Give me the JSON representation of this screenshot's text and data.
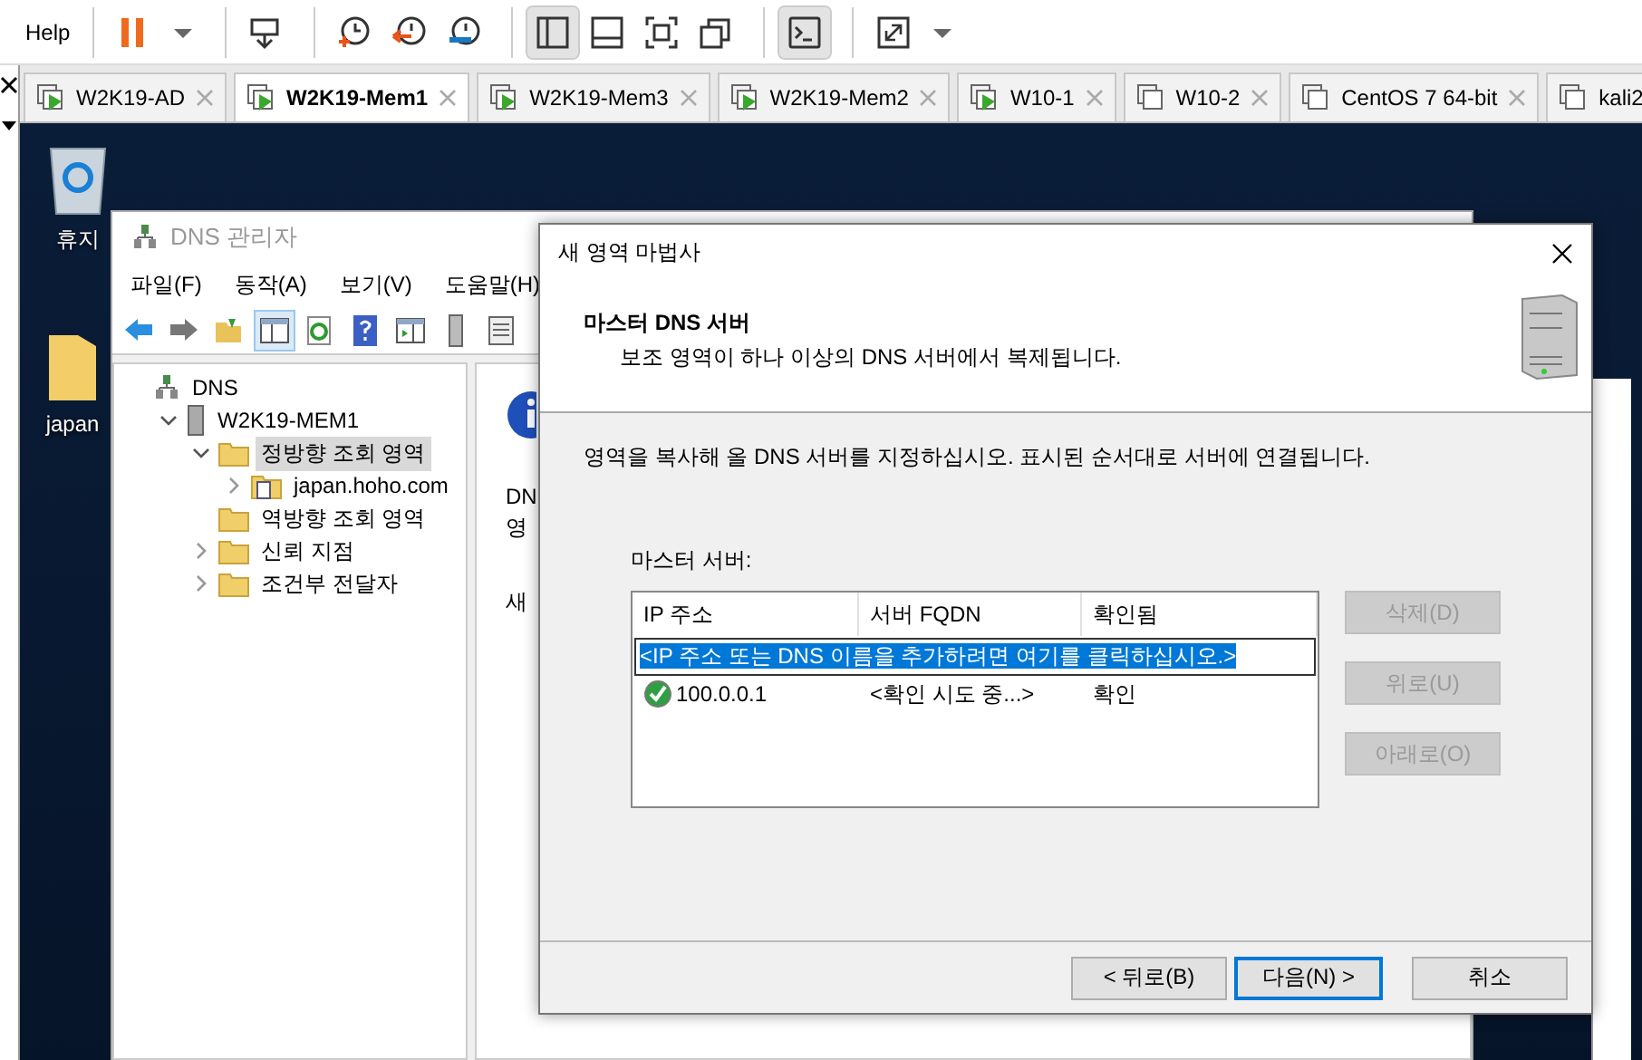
{
  "toolbar": {
    "help": "Help",
    "tool_groups": [
      [
        {
          "kind": "pause",
          "on": false
        },
        {
          "kind": "caret",
          "on": false
        }
      ],
      [
        {
          "kind": "send-keys",
          "on": false
        }
      ],
      [
        {
          "kind": "snapshot",
          "on": false
        },
        {
          "kind": "revert",
          "on": false
        },
        {
          "kind": "manage",
          "on": false
        }
      ],
      [
        {
          "kind": "sidebar",
          "on": true
        },
        {
          "kind": "bottom-panel",
          "on": false
        },
        {
          "kind": "fit",
          "on": false
        },
        {
          "kind": "restore",
          "on": false
        }
      ],
      [
        {
          "kind": "console",
          "on": true
        }
      ],
      [
        {
          "kind": "stretch",
          "on": false
        },
        {
          "kind": "caret",
          "on": false
        }
      ]
    ]
  },
  "tabs": [
    {
      "label": "W2K19-AD",
      "running": true,
      "selected": false
    },
    {
      "label": "W2K19-Mem1",
      "running": true,
      "selected": true
    },
    {
      "label": "W2K19-Mem3",
      "running": true,
      "selected": false
    },
    {
      "label": "W2K19-Mem2",
      "running": true,
      "selected": false
    },
    {
      "label": "W10-1",
      "running": true,
      "selected": false
    },
    {
      "label": "W10-2",
      "running": false,
      "selected": false
    },
    {
      "label": "CentOS 7 64-bit",
      "running": false,
      "selected": false
    },
    {
      "label": "kali2",
      "running": false,
      "selected": false
    }
  ],
  "desktop_icons": [
    {
      "kind": "recycle-bin",
      "label": "휴지"
    },
    {
      "kind": "folder",
      "label": "japan"
    }
  ],
  "dns_window": {
    "title": "DNS 관리자",
    "menu": [
      "파일(F)",
      "동작(A)",
      "보기(V)",
      "도움말(H)"
    ],
    "tools": [
      {
        "kind": "back",
        "on": false
      },
      {
        "kind": "forward",
        "on": false
      },
      {
        "kind": "up",
        "on": false
      },
      {
        "kind": "tree",
        "on": true
      },
      {
        "kind": "refresh",
        "on": false
      },
      {
        "kind": "help",
        "on": false
      },
      {
        "kind": "action-pane",
        "on": false
      },
      {
        "kind": "server",
        "on": false
      },
      {
        "kind": "list",
        "on": false
      }
    ],
    "tree": [
      {
        "label": "DNS",
        "kind": "root",
        "expandable": false,
        "selected": false,
        "children": [
          {
            "label": "W2K19-MEM1",
            "kind": "server",
            "expandable": true,
            "expanded": true,
            "selected": false,
            "children": [
              {
                "label": "정방향 조회 영역",
                "kind": "folder",
                "expandable": true,
                "expanded": true,
                "selected": true,
                "children": [
                  {
                    "label": "japan.hoho.com",
                    "kind": "zone",
                    "expandable": true,
                    "expanded": false,
                    "selected": false
                  }
                ]
              },
              {
                "label": "역방향 조회 영역",
                "kind": "folder",
                "expandable": false,
                "selected": false
              },
              {
                "label": "신뢰 지점",
                "kind": "folder",
                "expandable": true,
                "expanded": false,
                "selected": false
              },
              {
                "label": "조건부 전달자",
                "kind": "folder",
                "expandable": true,
                "expanded": false,
                "selected": false
              }
            ]
          }
        ]
      }
    ],
    "pane_texts": [
      "DN",
      "영",
      "새"
    ]
  },
  "wizard": {
    "title": "새 영역 마법사",
    "heading": "마스터 DNS 서버",
    "subheading": "보조 영역이 하나 이상의 DNS 서버에서 복제됩니다.",
    "instruction": "영역을 복사해 올 DNS 서버를 지정하십시오. 표시된 순서대로 서버에 연결됩니다.",
    "list_label": "마스터 서버:",
    "columns": [
      "IP 주소",
      "서버 FQDN",
      "확인됨"
    ],
    "edit_row": "<IP 주소 또는 DNS 이름을 추가하려면 여기를 클릭하십시오.>",
    "rows": [
      {
        "ip": "100.0.0.1",
        "fqdn": "<확인 시도 중...>",
        "status": "확인",
        "verified": true
      }
    ],
    "side_buttons": [
      {
        "label": "삭제(D)",
        "disabled": true
      },
      {
        "label": "위로(U)",
        "disabled": true
      },
      {
        "label": "아래로(O)",
        "disabled": true
      }
    ],
    "footer_buttons": [
      {
        "label": "< 뒤로(B)",
        "default": false
      },
      {
        "label": "다음(N) >",
        "default": true
      },
      {
        "label": "취소",
        "default": false
      }
    ]
  }
}
